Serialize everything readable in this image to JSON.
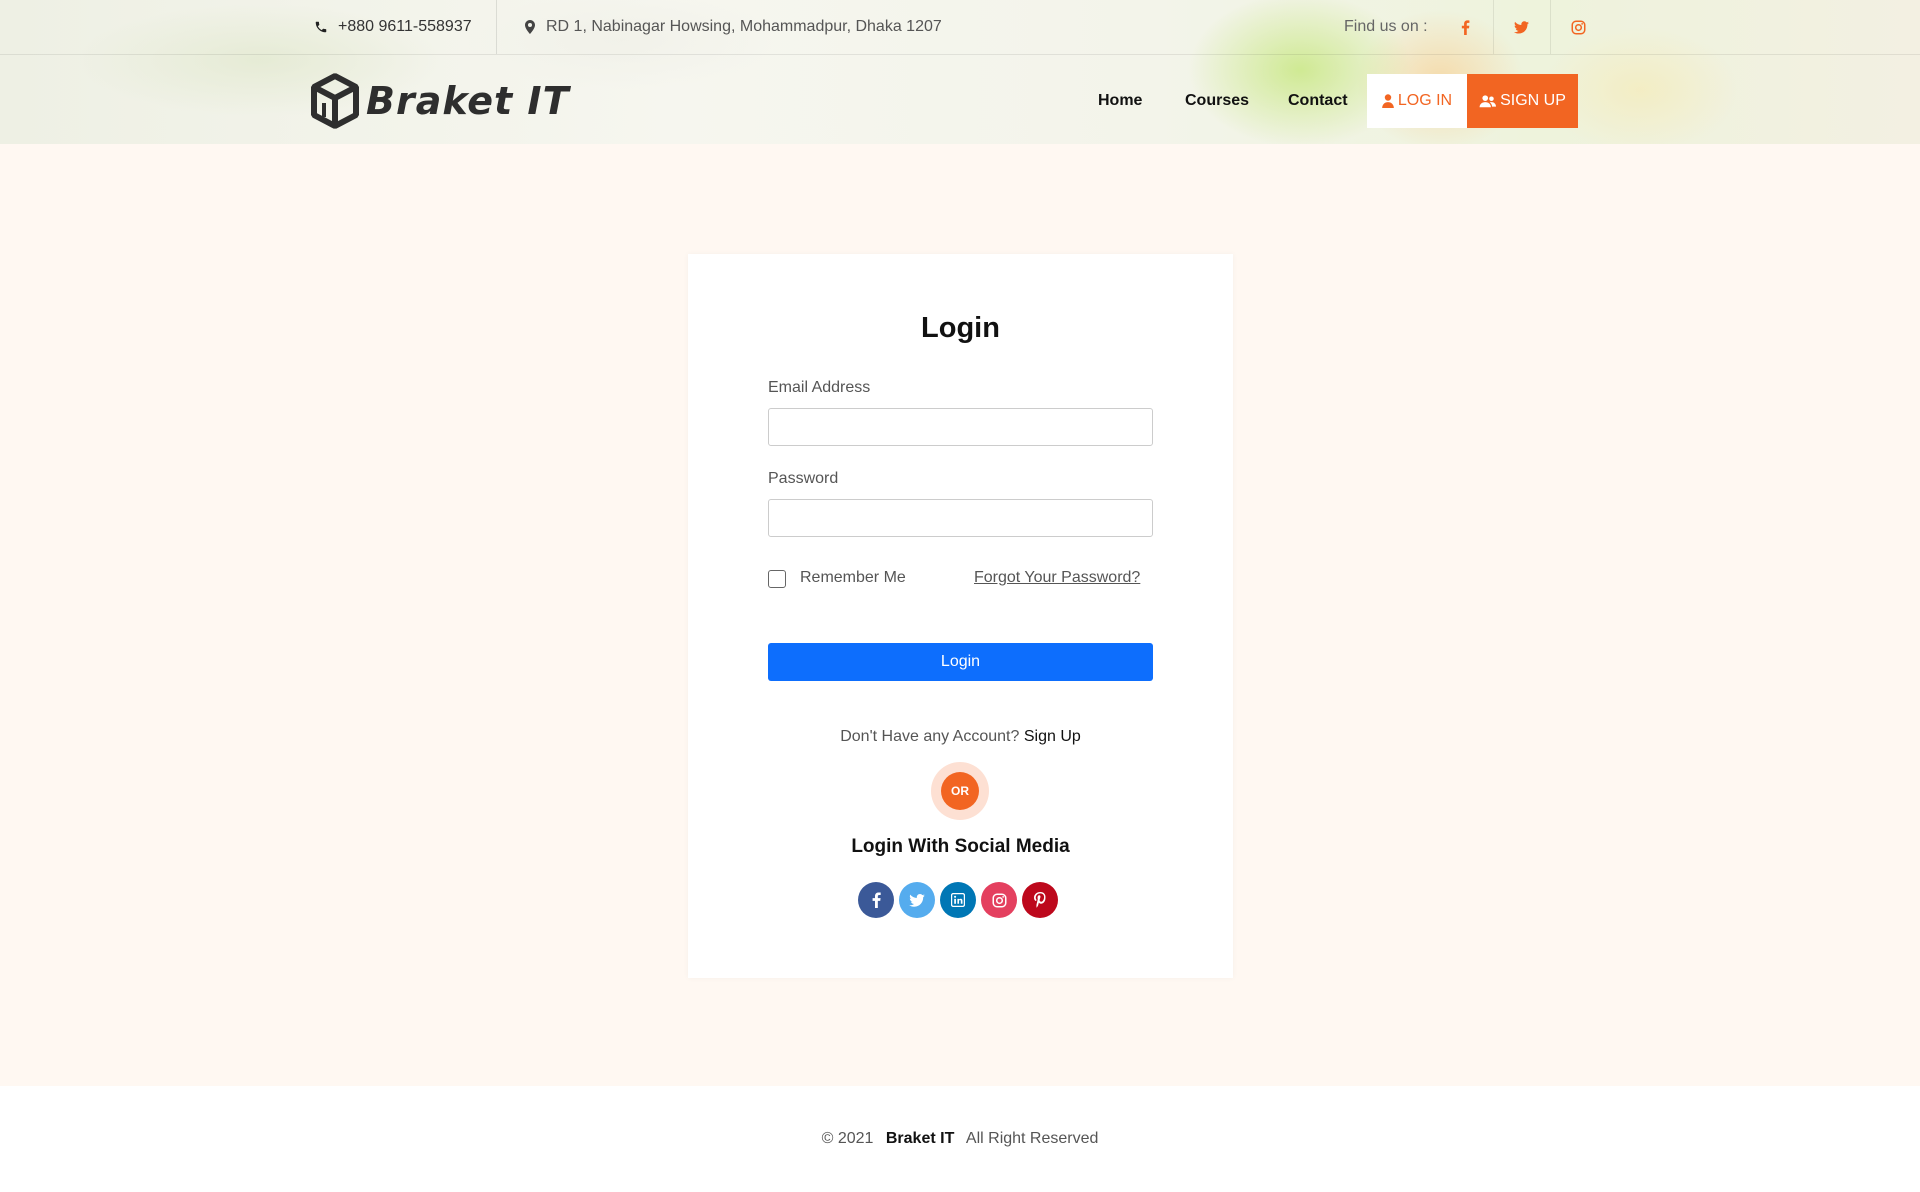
{
  "topbar": {
    "phone": "+880 9611-558937",
    "address": "RD 1, Nabinagar Howsing, Mohammadpur, Dhaka 1207",
    "find_us": "Find us on :",
    "social_icons": [
      "facebook-icon",
      "twitter-icon",
      "instagram-icon"
    ]
  },
  "brand": {
    "name": "Braket IT"
  },
  "nav": {
    "home": "Home",
    "courses": "Courses",
    "contact": "Contact",
    "login": "LOG IN",
    "signup": "SIGN UP"
  },
  "form": {
    "title": "Login",
    "email_label": "Email Address",
    "email_value": "",
    "password_label": "Password",
    "password_value": "",
    "remember_label": "Remember Me",
    "forgot_label": "Forgot Your Password?",
    "submit_label": "Login",
    "no_account_text": "Don't Have any Account?",
    "signup_link": "Sign Up",
    "or_label": "OR",
    "social_title": "Login With Social Media",
    "social_icons": [
      "facebook-icon",
      "twitter-icon",
      "linkedin-icon",
      "instagram-icon",
      "pinterest-icon"
    ]
  },
  "footer": {
    "copyright": "© 2021",
    "brand": "Braket IT",
    "rights": "All Right Reserved"
  },
  "colors": {
    "accent": "#f26522",
    "primary_button": "#0d6efd",
    "page_background": "#fff8f2"
  }
}
